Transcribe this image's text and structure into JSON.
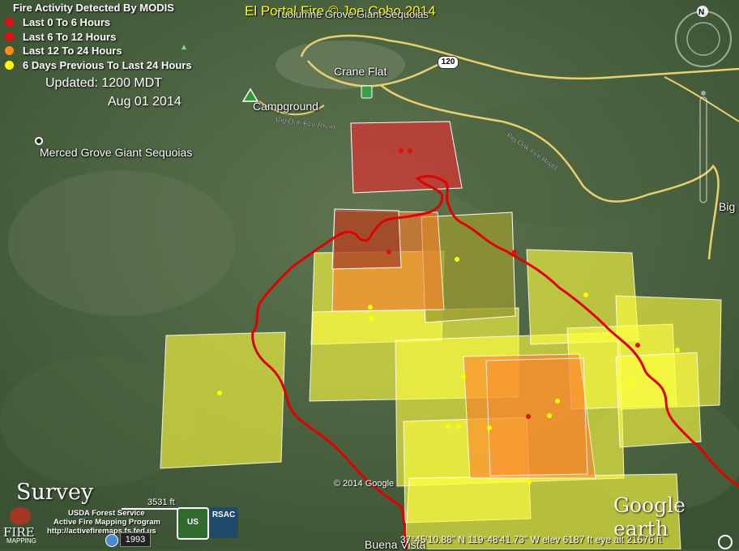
{
  "legend": {
    "title": "Fire Activity Detected By MODIS",
    "items": [
      {
        "label": "Last 0 To 6 Hours",
        "color": "#e01010"
      },
      {
        "label": "Last 6 To 12 Hours",
        "color": "#e01010"
      },
      {
        "label": "Last 12 To 24 Hours",
        "color": "#ff8c1a"
      },
      {
        "label": "6 Days Previous To Last 24 Hours",
        "color": "#ffff00"
      }
    ]
  },
  "updated": {
    "line1": "Updated: 1200 MDT",
    "line2": "Aug 01 2014"
  },
  "credit": "El Portal Fire  © Joe Coho 2014",
  "places": {
    "tuolumne": "Tuolumne Grove Giant Sequoias",
    "crane_flat": "Crane Flat",
    "campground": "Campground",
    "merced": "Merced Grove Giant Sequoias",
    "big": "Big",
    "buena_vista": "Buena Vista"
  },
  "roads": {
    "big_oak_flat_1": "Big Oak Flat Road",
    "big_oak_flat_2": "Big Oak Flat Road",
    "route_shield": "120"
  },
  "compass": {
    "north": "N"
  },
  "footer": {
    "copyright": "© 2014 Google",
    "coordinates": "37°45'10.88\" N  119°48'41.73\" W  elev  6187 ft     eye alt  21676 ft",
    "google_earth": "Google earth",
    "scale": "3531 ft",
    "year": "1993",
    "survey": "Survey",
    "usda_line1": "USDA Forest Service",
    "usda_line2": "Active Fire Mapping Program",
    "usda_line3": "http://activefiremaps.fs.fed.us",
    "fire_mapping": "FIRE",
    "fire_mapping2": "MAPPING",
    "usfs_badge": "US",
    "rsac_badge": "RSAC"
  },
  "colors": {
    "yellow_poly": "#ffff40",
    "orange_poly": "#ff7b2a",
    "red_poly": "#d83232",
    "perimeter": "#e00000",
    "road": "#e8d070"
  }
}
